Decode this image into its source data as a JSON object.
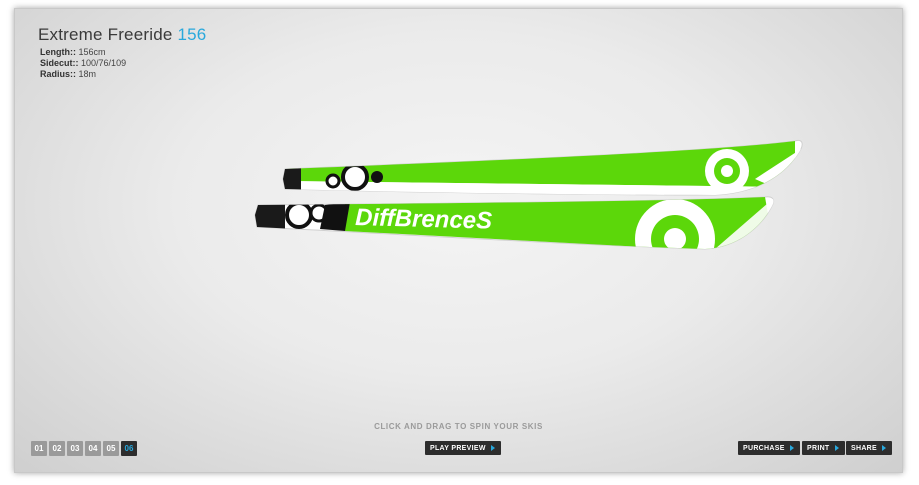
{
  "product": {
    "name": "Extreme Freeride",
    "number": "156"
  },
  "specs": [
    {
      "label": "Length::",
      "value": "156cm"
    },
    {
      "label": "Sidecut::",
      "value": "100/76/109"
    },
    {
      "label": "Radius::",
      "value": "18m"
    }
  ],
  "ski_graphic": {
    "text": "DiffBrenceS",
    "color": "#5cd70a"
  },
  "hint": "CLICK AND DRAG TO SPIN YOUR SKIS",
  "pages": [
    "01",
    "02",
    "03",
    "04",
    "05",
    "06"
  ],
  "active_page": "06",
  "buttons": {
    "play_preview": "PLAY PREVIEW",
    "purchase": "PURCHASE",
    "print": "PRINT",
    "share": "SHARE"
  }
}
